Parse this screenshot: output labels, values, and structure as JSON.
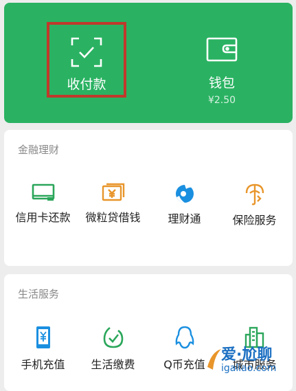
{
  "top_card": {
    "pay": {
      "label": "收付款",
      "icon": "scan-check-icon"
    },
    "wallet": {
      "label": "钱包",
      "balance": "¥2.50",
      "icon": "wallet-icon"
    }
  },
  "finance": {
    "title": "金融理财",
    "items": [
      {
        "label": "信用卡还款",
        "icon": "credit-card-icon"
      },
      {
        "label": "微粒贷借钱",
        "icon": "loan-yuan-icon"
      },
      {
        "label": "理财通",
        "icon": "licaitong-icon"
      },
      {
        "label": "保险服务",
        "icon": "insurance-umbrella-icon"
      }
    ]
  },
  "life": {
    "title": "生活服务",
    "items": [
      {
        "label": "手机充值",
        "icon": "phone-yuan-icon"
      },
      {
        "label": "生活缴费",
        "icon": "bill-check-icon"
      },
      {
        "label": "Q币充值",
        "icon": "qq-penguin-icon"
      },
      {
        "label": "城市服务",
        "icon": "city-building-icon"
      }
    ]
  },
  "watermark": {
    "main": "爱·尬聊",
    "sub": "igaliao.com"
  },
  "colors": {
    "brand_green": "#2ab262",
    "highlight_red": "#c0392b",
    "finance_green": "#2aa65a",
    "finance_orange": "#e8952a",
    "finance_blue": "#1a8fe0",
    "life_blue": "#1a8fe0"
  }
}
